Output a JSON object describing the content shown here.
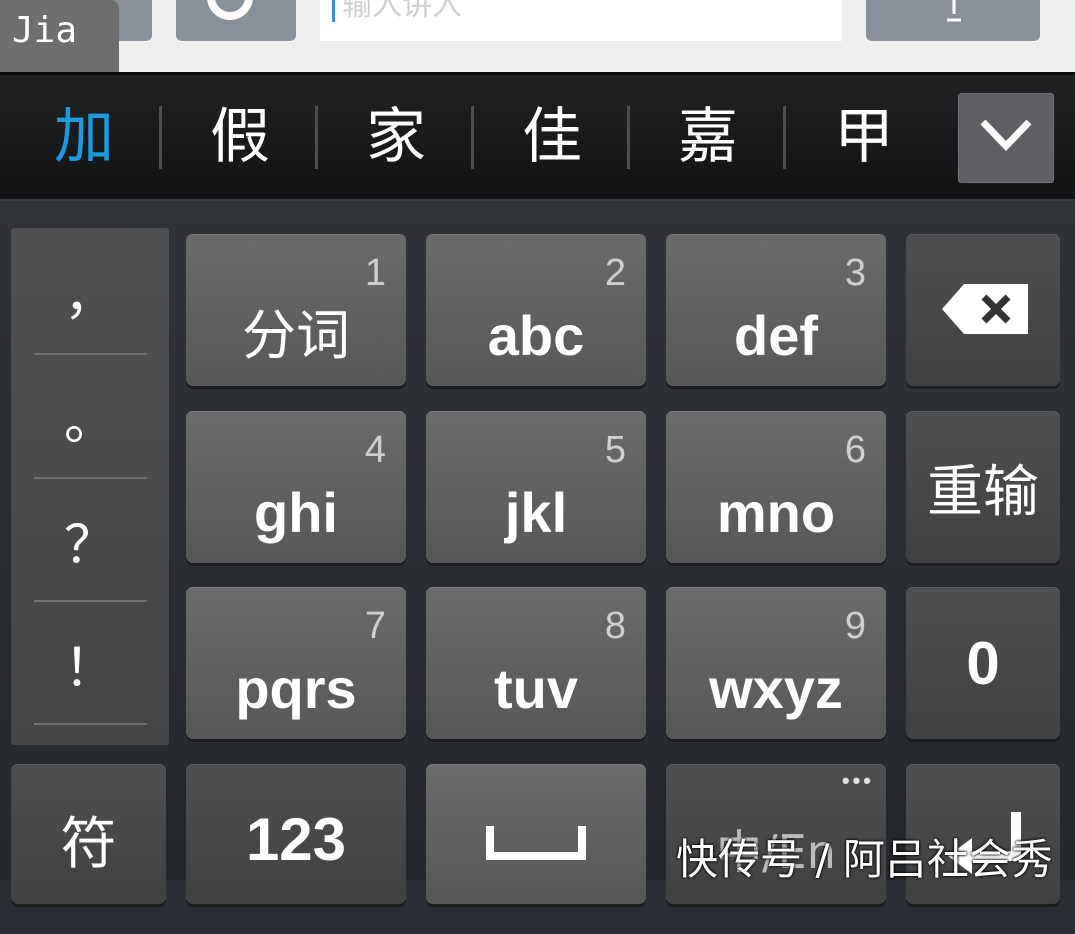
{
  "topbar": {
    "search_placeholder": "输入讲入",
    "pinyin_label": "Jia"
  },
  "candidates": [
    "加",
    "假",
    "家",
    "佳",
    "嘉",
    "甲"
  ],
  "punctuation": [
    "，",
    "。",
    "？",
    "！"
  ],
  "keys": {
    "row1": [
      {
        "num": "1",
        "label": "分词"
      },
      {
        "num": "2",
        "label": "abc"
      },
      {
        "num": "3",
        "label": "def"
      }
    ],
    "row2": [
      {
        "num": "4",
        "label": "ghi"
      },
      {
        "num": "5",
        "label": "jkl"
      },
      {
        "num": "6",
        "label": "mno"
      }
    ],
    "row3": [
      {
        "num": "7",
        "label": "pqrs"
      },
      {
        "num": "8",
        "label": "tuv"
      },
      {
        "num": "9",
        "label": "wxyz"
      }
    ],
    "retype": "重输",
    "zero": "0",
    "symbol": "符",
    "numbers": "123",
    "lang_switch": "中/En",
    "more": "•••"
  },
  "watermark": "快传号 / 阿吕社会秀",
  "colors": {
    "candidate_highlight": "#1b9ae0",
    "key_face": "#606060",
    "keyboard_bg": "#2a2d33"
  }
}
